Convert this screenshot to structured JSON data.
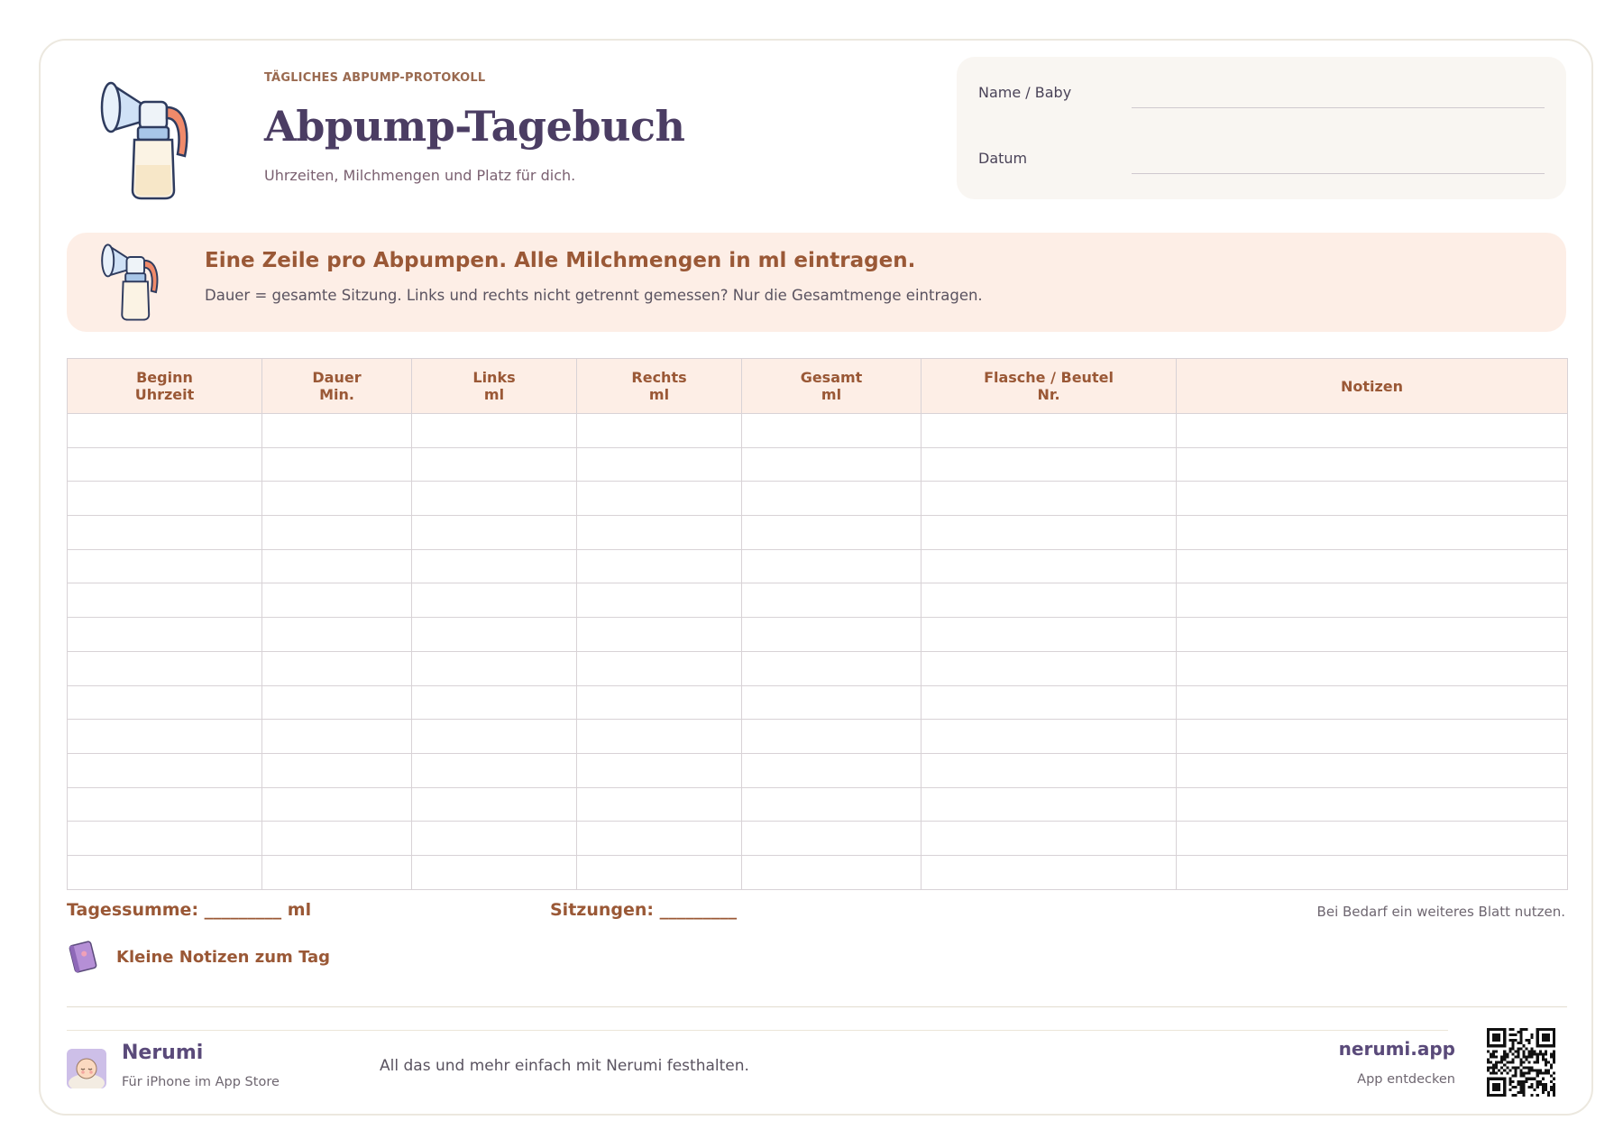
{
  "header": {
    "eyebrow": "TÄGLICHES ABPUMP-PROTOKOLL",
    "title": "Abpump-Tagebuch",
    "subtitle": "Uhrzeiten, Milchmengen und Platz für dich."
  },
  "info": {
    "name_label": "Name / Baby",
    "date_label": "Datum"
  },
  "banner": {
    "title": "Eine Zeile pro Abpumpen. Alle Milchmengen in ml eintragen.",
    "text": "Dauer = gesamte Sitzung. Links und rechts nicht getrennt gemessen? Nur die Gesamtmenge eintragen."
  },
  "table": {
    "columns": [
      {
        "line1": "Beginn",
        "line2": "Uhrzeit"
      },
      {
        "line1": "Dauer",
        "line2": "Min."
      },
      {
        "line1": "Links",
        "line2": "ml"
      },
      {
        "line1": "Rechts",
        "line2": "ml"
      },
      {
        "line1": "Gesamt",
        "line2": "ml"
      },
      {
        "line1": "Flasche / Beutel",
        "line2": "Nr."
      },
      {
        "line1": "Notizen",
        "line2": ""
      }
    ],
    "empty_rows": 14
  },
  "totals": {
    "daily_sum": "Tagessumme: _________ ml",
    "sessions": "Sitzungen: _________",
    "hint": "Bei Bedarf ein weiteres Blatt nutzen."
  },
  "notes": {
    "label": "Kleine Notizen zum Tag",
    "icon": "notebook-icon"
  },
  "footer": {
    "brand": "Nerumi",
    "brand_sub": "Für iPhone im App Store",
    "tagline": "All das und mehr einfach mit Nerumi festhalten.",
    "site": "nerumi.app",
    "site_sub": "App entdecken"
  },
  "icons": {
    "hero": "breast-pump-icon",
    "banner": "breast-pump-icon",
    "avatar": "baby-avatar-icon",
    "qr": "qr-code"
  },
  "colors": {
    "title": "#4b3d63",
    "accent": "#9a5836",
    "banner_bg": "#fdeee6",
    "info_bg": "#f9f6f2"
  }
}
